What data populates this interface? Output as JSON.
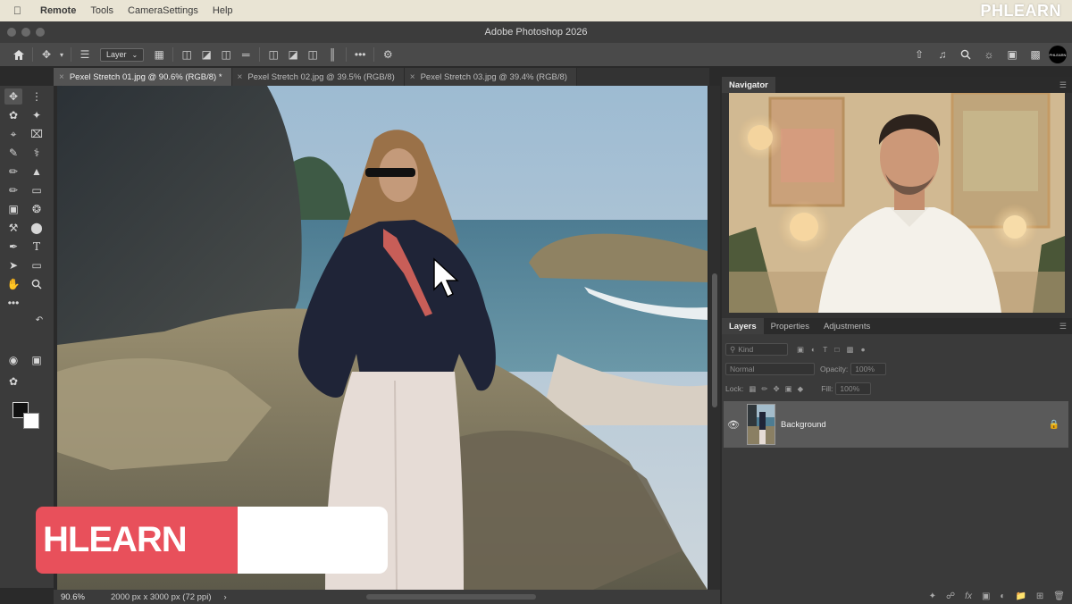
{
  "menubar": {
    "items": [
      "Remote",
      "Tools",
      "CameraSettings",
      "Help"
    ],
    "brand_watermark": "PHLEARN"
  },
  "window": {
    "title": "Adobe Photoshop 2026"
  },
  "options_bar": {
    "layer_select": "Layer",
    "icons": [
      "home-icon",
      "move-icon",
      "layers-stack-icon",
      "transform-controls-icon",
      "align-left-icon",
      "align-center-icon",
      "align-right-icon",
      "distribute-icon",
      "align-top-icon",
      "align-middle-icon",
      "align-bottom-icon",
      "distribute-vertical-icon",
      "more-icon",
      "gear-icon"
    ],
    "right_icons": [
      "share-icon",
      "bell-icon",
      "search-icon",
      "lightbulb-icon",
      "workspace-icon",
      "plugins-icon",
      "account-avatar"
    ],
    "avatar_text": "PHLEARN"
  },
  "tabs": [
    {
      "label": "Pexel Stretch 01.jpg @ 90.6% (RGB/8) *",
      "active": true
    },
    {
      "label": "Pexel Stretch 02.jpg @ 39.5% (RGB/8)",
      "active": false
    },
    {
      "label": "Pexel Stretch 03.jpg @ 39.4% (RGB/8)",
      "active": false
    }
  ],
  "status": {
    "zoom": "90.6%",
    "doc_info": "2000 px x 3000 px (72 ppi)",
    "arrow": "›"
  },
  "lower_third": {
    "text": "HLEARN"
  },
  "navigator": {
    "tab": "Navigator"
  },
  "layers_panel": {
    "tabs": [
      "Layers",
      "Properties",
      "Adjustments"
    ],
    "kind_filter": "Kind",
    "blend_mode": "Normal",
    "opacity_label": "Opacity:",
    "opacity_value": "100%",
    "lock_label": "Lock:",
    "fill_label": "Fill:",
    "fill_value": "100%",
    "layer_name": "Background"
  },
  "colors": {
    "accent_red": "#e8505b",
    "panel_bg": "#323232",
    "menubar_bg": "#e9e4d4"
  }
}
